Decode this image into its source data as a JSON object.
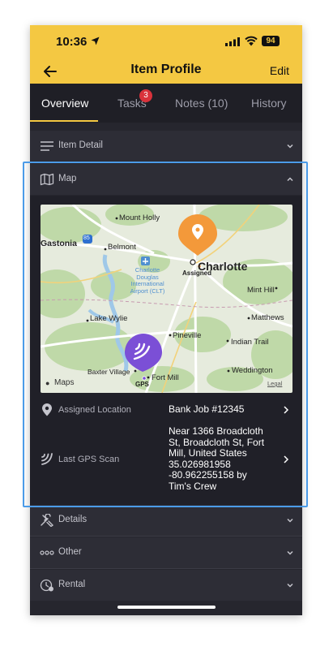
{
  "status": {
    "time": "10:36",
    "battery": "94"
  },
  "nav": {
    "title": "Item Profile",
    "edit": "Edit"
  },
  "tabs": [
    {
      "label": "Overview"
    },
    {
      "label": "Tasks",
      "badge": "3"
    },
    {
      "label": "Notes (10)"
    },
    {
      "label": "History"
    }
  ],
  "sections": {
    "item_detail": "Item Detail",
    "map": "Map",
    "details": "Details",
    "other": "Other",
    "rental": "Rental"
  },
  "map": {
    "cities": [
      "Mount Holly",
      "Gastonia",
      "Belmont",
      "Charlotte",
      "Mint Hill",
      "Lake Wylie",
      "Matthews",
      "Pineville",
      "Indian Trail",
      "Weddington",
      "Baxter Village",
      "Fort Mill"
    ],
    "airport": [
      "Charlotte",
      "Douglas",
      "International",
      "Airport (CLT)"
    ],
    "highway": "85",
    "assigned_label": "Assigned",
    "gps_label": "GPS",
    "attribution": "Maps",
    "legal": "Legal"
  },
  "info": {
    "assigned_label": "Assigned Location",
    "assigned_value": "Bank Job #12345",
    "gps_label": "Last GPS Scan",
    "gps_lines": [
      "Near 1366 Broadcloth",
      "St, Broadcloth St, Fort",
      "Mill, United States",
      "35.026981958",
      "-80.962255158 by",
      "Tim's Crew"
    ]
  },
  "colors": {
    "accent": "#f4c842",
    "assigned_pin": "#f3993a",
    "gps_pin": "#7b4fd6",
    "selection": "#4b9be8"
  }
}
